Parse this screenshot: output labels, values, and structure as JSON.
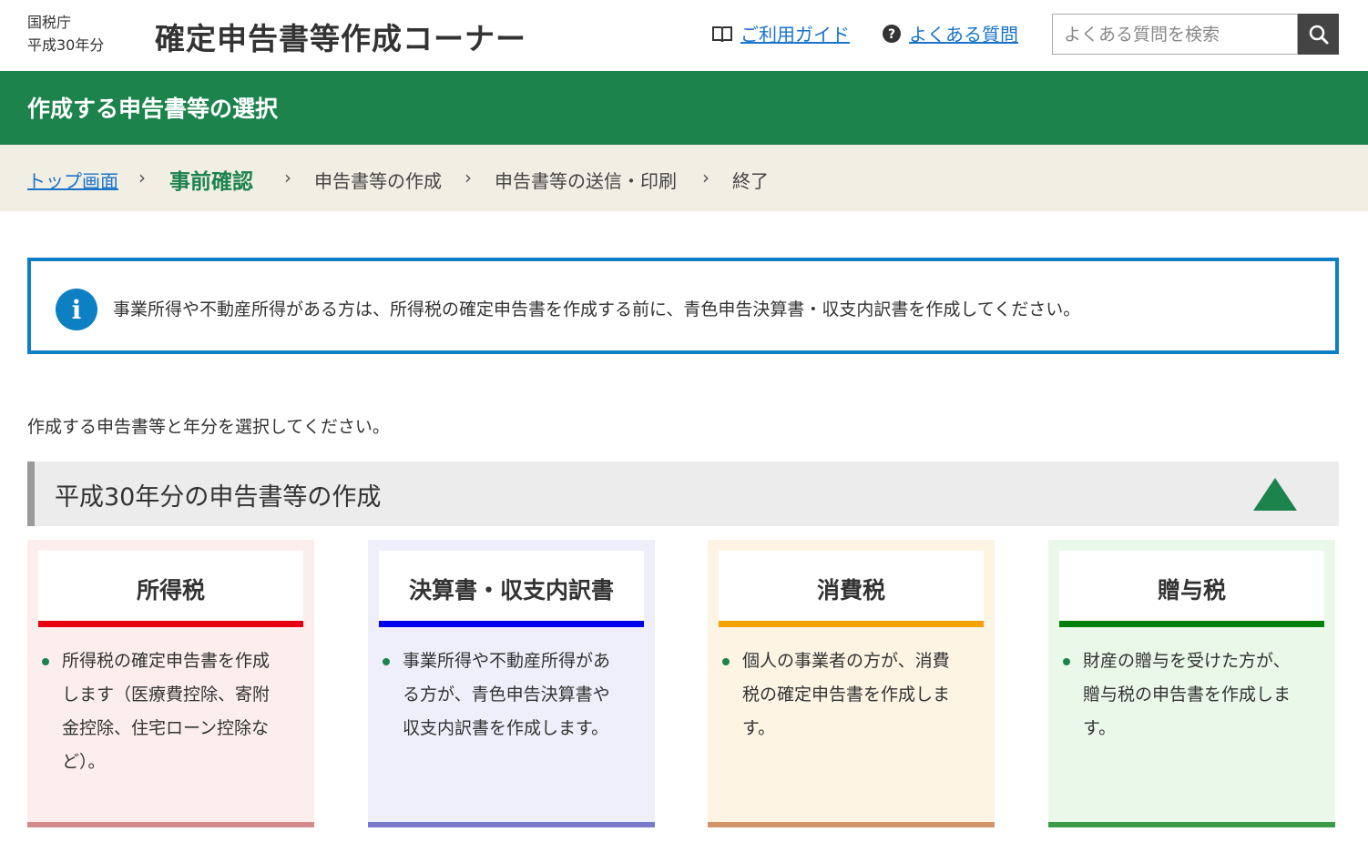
{
  "header": {
    "agency": "国税庁",
    "year": "平成30年分",
    "title": "確定申告書等作成コーナー",
    "guide_link": "ご利用ガイド",
    "faq_link": "よくある質問",
    "search_placeholder": "よくある質問を検索"
  },
  "page": {
    "title": "作成する申告書等の選択"
  },
  "breadcrumb": {
    "items": [
      {
        "label": "トップ画面",
        "state": "link"
      },
      {
        "label": "事前確認",
        "state": "current"
      },
      {
        "label": "申告書等の作成",
        "state": "upcoming"
      },
      {
        "label": "申告書等の送信・印刷",
        "state": "upcoming"
      },
      {
        "label": "終了",
        "state": "upcoming"
      }
    ],
    "separator": "›"
  },
  "info": {
    "icon": "info-icon",
    "message": "事業所得や不動産所得がある方は、所得税の確定申告書を作成する前に、青色申告決算書・収支内訳書を作成してください。"
  },
  "instruction": "作成する申告書等と年分を選択してください。",
  "section": {
    "title": "平成30年分の申告書等の作成",
    "expanded": true
  },
  "cards": [
    {
      "title": "所得税",
      "accent": "#e60012",
      "desc_lines": [
        "所得税の確定申告書を作成",
        "します（医療費控除、寄附",
        "金控除、住宅ローン控除な",
        "ど）。"
      ]
    },
    {
      "title": "決算書・収支内訳書",
      "accent": "#0000ee",
      "desc_lines": [
        "事業所得や不動産所得があ",
        "る方が、青色申告決算書や",
        "収支内訳書を作成します。"
      ]
    },
    {
      "title": "消費税",
      "accent": "#f5a200",
      "desc_lines": [
        "個人の事業者の方が、消費",
        "税の確定申告書を作成しま",
        "す。"
      ]
    },
    {
      "title": "贈与税",
      "accent": "#00800a",
      "desc_lines": [
        "財産の贈与を受けた方が、",
        "贈与税の申告書を作成しま",
        "す。"
      ]
    }
  ]
}
